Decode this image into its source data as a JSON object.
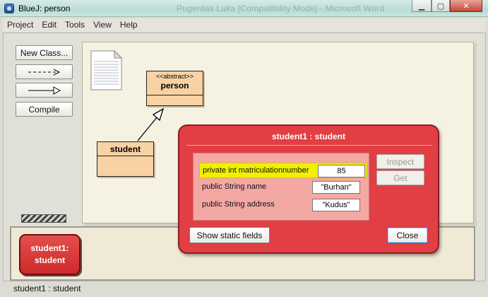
{
  "window": {
    "title": "BlueJ:  person",
    "background_title": "Pugerdas Luka [Compatibility Mode] - Microsoft Word"
  },
  "menu": [
    "Project",
    "Edit",
    "Tools",
    "View",
    "Help"
  ],
  "toolbar": {
    "new_class_label": "New Class...",
    "compile_label": "Compile"
  },
  "diagram": {
    "classes": [
      {
        "stereotype": "<<abstract>>",
        "name": "person"
      },
      {
        "stereotype": "",
        "name": "student"
      }
    ]
  },
  "inspector": {
    "title": "student1 : student",
    "fields": [
      {
        "name": "private int matriculationnumber",
        "value": "85",
        "selected": true
      },
      {
        "name": "public String name",
        "value": "\"Burhan\"",
        "selected": false
      },
      {
        "name": "public String address",
        "value": "\"Kudus\"",
        "selected": false
      }
    ],
    "inspect_label": "Inspect",
    "get_label": "Get",
    "show_static_label": "Show static fields",
    "close_label": "Close"
  },
  "bench": {
    "object_line1": "student1:",
    "object_line2": "student"
  },
  "status": "student1 : student",
  "colors": {
    "class_fill": "#f8d1a4",
    "dialog_red": "#e13f43",
    "object_red": "#cd2a2a",
    "selection_yellow": "#f0f000"
  }
}
